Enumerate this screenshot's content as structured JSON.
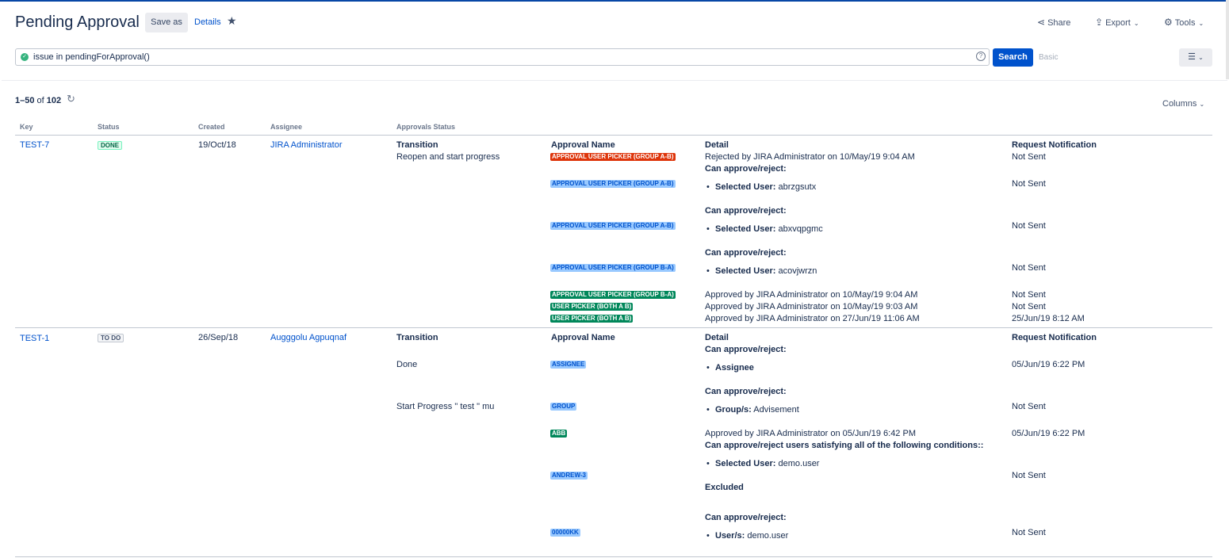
{
  "header": {
    "title": "Pending Approval",
    "save_as": "Save as",
    "details": "Details",
    "share": "Share",
    "export": "Export",
    "tools": "Tools"
  },
  "search": {
    "query": "issue in pendingForApproval()",
    "search_button": "Search",
    "basic": "Basic"
  },
  "results": {
    "range": "1–50",
    "of": "of",
    "total": "102",
    "columns_button": "Columns"
  },
  "table": {
    "headers": [
      "Key",
      "Status",
      "Created",
      "Assignee",
      "Approvals Status"
    ],
    "sub_headers": {
      "transition": "Transition",
      "approval_name": "Approval Name",
      "detail": "Detail",
      "request_notification": "Request Notification"
    },
    "rows": [
      {
        "key": "TEST-7",
        "status": "DONE",
        "created": "19/Oct/18",
        "assignee": "JIRA Administrator",
        "transitions": [
          "Reopen and start progress"
        ],
        "approvals": [
          {
            "name": "APPROVAL USER PICKER (GROUP A-B)",
            "state": "rejected",
            "detail": "Rejected by JIRA Administrator on 10/May/19 9:04 AM",
            "notification": "Not Sent"
          },
          {
            "name": "APPROVAL USER PICKER (GROUP A-B)",
            "state": "pending",
            "can_approve": "Can approve/reject:",
            "bullet_label": "Selected User:",
            "bullet_value": "abrzgsutx",
            "notification": "Not Sent"
          },
          {
            "name": "APPROVAL USER PICKER (GROUP A-B)",
            "state": "pending",
            "can_approve": "Can approve/reject:",
            "bullet_label": "Selected User:",
            "bullet_value": "abxvqpgmc",
            "notification": "Not Sent"
          },
          {
            "name": "APPROVAL USER PICKER (GROUP B-A)",
            "state": "pending",
            "can_approve": "Can approve/reject:",
            "bullet_label": "Selected User:",
            "bullet_value": "acovjwrzn",
            "notification": "Not Sent"
          },
          {
            "name": "APPROVAL USER PICKER (GROUP B-A)",
            "state": "approved",
            "detail": "Approved by JIRA Administrator on 10/May/19 9:04 AM",
            "notification": "Not Sent"
          },
          {
            "name": "USER PICKER (BOTH A B)",
            "state": "approved",
            "detail": "Approved by JIRA Administrator on 10/May/19 9:03 AM",
            "notification": "Not Sent"
          },
          {
            "name": "USER PICKER (BOTH A B)",
            "state": "approved",
            "detail": "Approved by JIRA Administrator on 27/Jun/19 11:06 AM",
            "notification": "25/Jun/19 8:12 AM"
          }
        ]
      },
      {
        "key": "TEST-1",
        "status": "TO DO",
        "created": "26/Sep/18",
        "assignee": "Augggolu Agpuqnaf",
        "transitions": [
          "Done",
          "Start Progress \" test \" mu"
        ],
        "approvals": [
          {
            "name": "ASSIGNEE",
            "state": "pending",
            "can_approve": "Can approve/reject:",
            "bullet_label": "Assignee",
            "bullet_value": "",
            "notification": "05/Jun/19 6:22 PM"
          },
          {
            "name": "GROUP",
            "state": "pending",
            "can_approve": "Can approve/reject:",
            "bullet_label": "Group/s:",
            "bullet_value": "Advisement",
            "notification": "Not Sent"
          },
          {
            "name": "ABB",
            "state": "approved",
            "detail": "Approved by JIRA Administrator on 05/Jun/19 6:42 PM",
            "notification": "05/Jun/19 6:22 PM"
          },
          {
            "name": "ANDREW-3",
            "state": "pending",
            "can_approve": "Can approve/reject users satisfying all of the following conditions::",
            "bullet_label": "Selected User:",
            "bullet_value": "demo.user",
            "excluded": "Excluded",
            "notification": "Not Sent"
          },
          {
            "name": "00000KK",
            "state": "pending",
            "can_approve": "Can approve/reject:",
            "bullet_label": "User/s:",
            "bullet_value": "demo.user",
            "notification": "Not Sent"
          }
        ]
      }
    ]
  }
}
